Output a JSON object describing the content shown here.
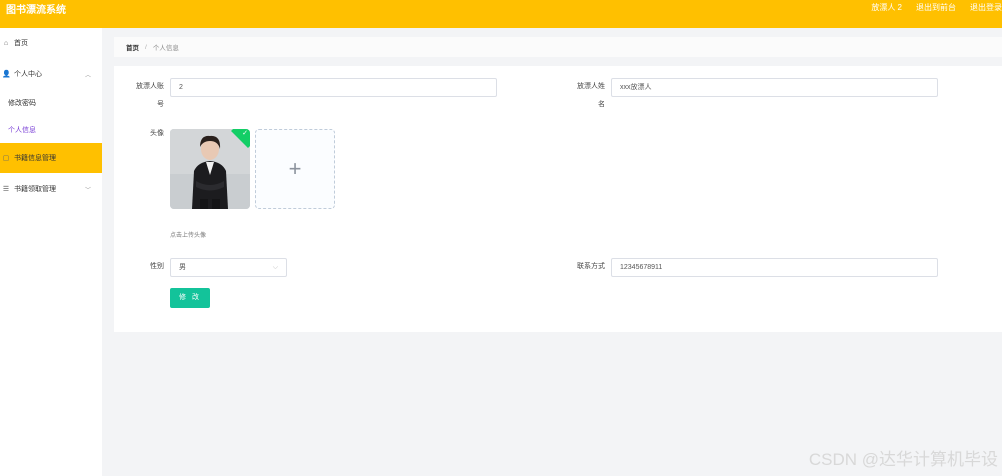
{
  "app": {
    "title": "图书漂流系统",
    "user_name": "放漂人 2",
    "back_to_front": "退出到前台",
    "logout": "退出登录"
  },
  "sidebar": {
    "home": "首页",
    "personal_center": "个人中心",
    "change_password": "修改密码",
    "personal_info": "个人信息",
    "book_info_mgmt": "书籍信息管理",
    "book_claim_mgmt": "书籍领取管理"
  },
  "breadcrumb": {
    "home": "首页",
    "separator": "/",
    "current": "个人信息"
  },
  "form": {
    "account_label_1": "放漂人账",
    "account_label_2": "号",
    "account_value": "2",
    "name_label_1": "放漂人姓",
    "name_label_2": "名",
    "name_value": "xxx放漂人",
    "avatar_label": "头像",
    "upload_plus": "+",
    "upload_hint": "点击上传头像",
    "gender_label": "性别",
    "gender_value": "男",
    "contact_label": "联系方式",
    "contact_value": "12345678911",
    "submit_label": "修 改"
  },
  "watermark": "CSDN @达华计算机毕设",
  "colors": {
    "topbar": "#ffc000",
    "active_menu": "#ffc000",
    "active_sub_text": "#7a3fd6",
    "submit_button": "#13c39a",
    "success_badge": "#13ce66"
  }
}
